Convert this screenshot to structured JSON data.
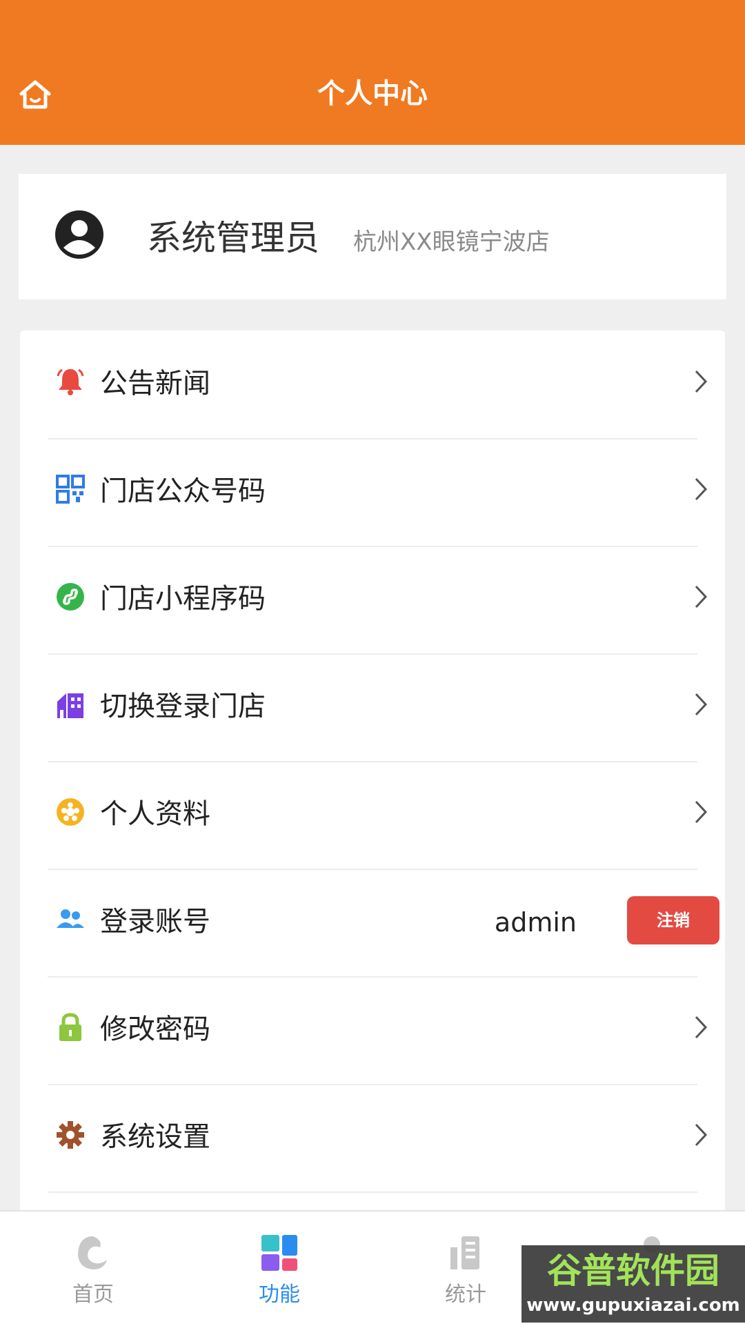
{
  "header": {
    "title": "个人中心",
    "home_icon": "home-icon"
  },
  "profile": {
    "name": "系统管理员",
    "store": "杭州XX眼镜宁波店",
    "avatar_icon": "user-avatar-icon"
  },
  "menu": {
    "items": [
      {
        "label": "公告新闻",
        "icon": "bell-icon",
        "color": "#e94a3f"
      },
      {
        "label": "门店公众号码",
        "icon": "qrcode-icon",
        "color": "#2f7be8"
      },
      {
        "label": "门店小程序码",
        "icon": "mini-program-icon",
        "color": "#35b44a"
      },
      {
        "label": "切换登录门店",
        "icon": "store-building-icon",
        "color": "#7b3fe4"
      },
      {
        "label": "个人资料",
        "icon": "profile-icon",
        "color": "#f5b321"
      },
      {
        "label": "登录账号",
        "icon": "users-icon",
        "color": "#3a9af0",
        "value": "admin",
        "action": "注销"
      },
      {
        "label": "修改密码",
        "icon": "lock-icon",
        "color": "#8dc63f"
      },
      {
        "label": "系统设置",
        "icon": "gear-icon",
        "color": "#a0522d"
      }
    ]
  },
  "tabbar": {
    "tabs": [
      {
        "label": "首页",
        "icon": "home-tab-icon"
      },
      {
        "label": "功能",
        "icon": "function-grid-icon",
        "active": true
      },
      {
        "label": "统计",
        "icon": "statistics-icon"
      },
      {
        "label": "",
        "icon": "profile-tab-icon"
      }
    ]
  },
  "watermark": {
    "text": "谷普软件园",
    "url_text": "www.gupuxiazai.com"
  },
  "colors": {
    "header_bg": "#f07a21",
    "active_tab": "#2a8cf0",
    "logout_bg": "#e34a42"
  }
}
